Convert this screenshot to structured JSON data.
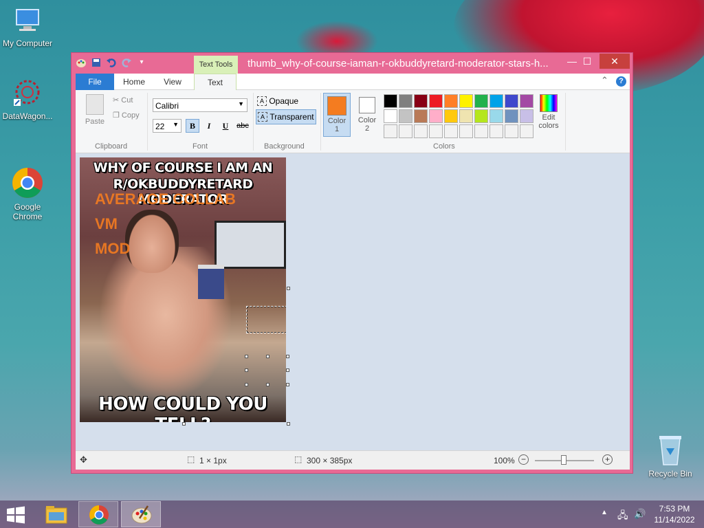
{
  "desktop": {
    "icons": [
      {
        "label": "My Computer",
        "icon": "computer-icon"
      },
      {
        "label": "DataWagon...",
        "icon": "datawagon-icon"
      },
      {
        "label": "Google\nChrome",
        "icon": "chrome-icon"
      },
      {
        "label": "Recycle Bin",
        "icon": "recycle-bin-icon"
      }
    ]
  },
  "window": {
    "title": "thumb_why-of-course-iaman-r-okbuddyretard-moderator-stars-h...",
    "contextual_tab_group": "Text Tools",
    "tabs": [
      "File",
      "Home",
      "View",
      "Text"
    ],
    "active_tab": "Text"
  },
  "ribbon": {
    "clipboard": {
      "label": "Clipboard",
      "paste": "Paste",
      "cut": "Cut",
      "copy": "Copy"
    },
    "font": {
      "label": "Font",
      "family": "Calibri",
      "size": "22",
      "bold": "B",
      "italic": "I",
      "underline": "U",
      "strike": "abc"
    },
    "background": {
      "label": "Background",
      "opaque": "Opaque",
      "transparent": "Transparent"
    },
    "colors": {
      "label": "Colors",
      "color1_label": "Color\n1",
      "color2_label": "Color\n2",
      "color1": "#f47c20",
      "color2": "#ffffff",
      "edit_colors": "Edit\ncolors",
      "palette_row1": [
        "#000000",
        "#7f7f7f",
        "#880015",
        "#ed1c24",
        "#ff7f27",
        "#fff200",
        "#22b14c",
        "#00a2e8",
        "#3f48cc",
        "#a349a4"
      ],
      "palette_row2": [
        "#ffffff",
        "#c3c3c3",
        "#b97a57",
        "#ffaec9",
        "#ffc90e",
        "#efe4b0",
        "#b5e61d",
        "#99d9ea",
        "#7092be",
        "#c8bfe7"
      ],
      "palette_row3": [
        "#f2f2f2",
        "#f2f2f2",
        "#f2f2f2",
        "#f2f2f2",
        "#f2f2f2",
        "#f2f2f2",
        "#f2f2f2",
        "#f2f2f2",
        "#f2f2f2",
        "#f2f2f2"
      ]
    }
  },
  "canvas": {
    "meme_top_1": "WHY OF COURSE I AM AN",
    "meme_top_2": "R/OKBUDDYRETARD MODERATOR",
    "overlay_1": "AVERAGE COLLAB",
    "overlay_2": "VM",
    "overlay_3": "MOD",
    "meme_bottom": "HOW COULD YOU TELL?"
  },
  "statusbar": {
    "selection": "1 × 1px",
    "image_size": "300 × 385px",
    "zoom": "100%"
  },
  "taskbar": {
    "time": "7:53 PM",
    "date": "11/14/2022"
  }
}
